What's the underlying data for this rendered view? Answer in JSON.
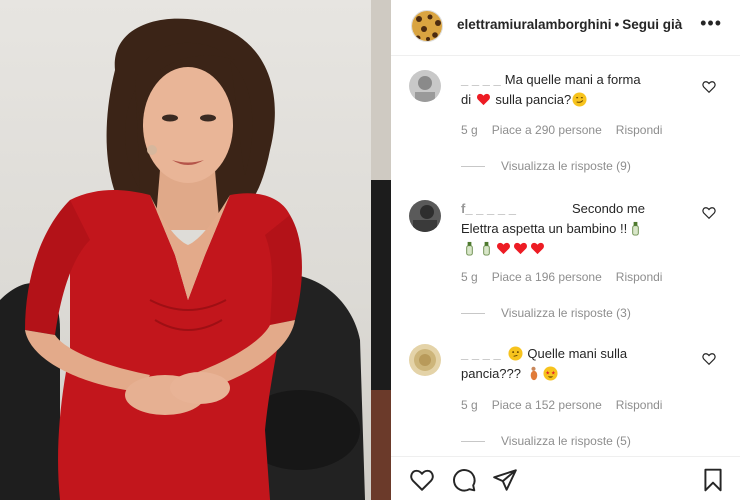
{
  "post": {
    "username": "elettramiuralamborghini",
    "separator": "•",
    "follow_label": "Segui già",
    "more_icon": "more-horizontal-icon"
  },
  "comments": [
    {
      "user": "_ _ _ _",
      "text_a": "Ma quelle mani a forma",
      "text_b": "di",
      "text_c": "sulla pancia?",
      "time": "5 g",
      "likes": "Piace a 290 persone",
      "reply": "Rispondi",
      "view_replies": "Visualizza le risposte (9)"
    },
    {
      "user": "f_ _ _ _ _",
      "text_a": "Secondo me",
      "text_b": "Elettra aspetta un bambino !!",
      "time": "5 g",
      "likes": "Piace a 196 persone",
      "reply": "Rispondi",
      "view_replies": "Visualizza le risposte (3)"
    },
    {
      "user": "_ _ _ _",
      "text_a": "Quelle mani sulla",
      "text_b": "pancia???",
      "time": "5 g",
      "likes": "Piace a 152 persone",
      "reply": "Rispondi",
      "view_replies": "Visualizza le risposte (5)"
    }
  ],
  "actions": {
    "like_icon": "heart-icon",
    "comment_icon": "comment-icon",
    "share_icon": "send-icon",
    "save_icon": "bookmark-icon"
  },
  "colors": {
    "dress_red": "#c2161c",
    "text_primary": "#262626",
    "text_secondary": "#8e8e8e",
    "heart_red": "#ed1c24"
  }
}
